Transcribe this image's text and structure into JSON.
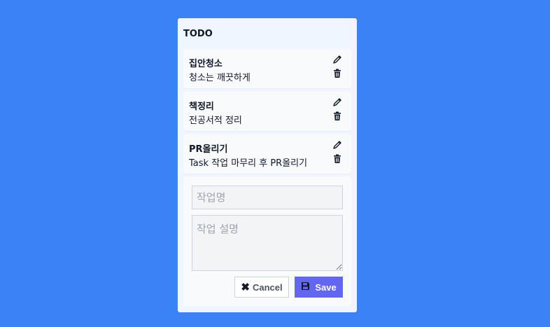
{
  "panel": {
    "title": "TODO"
  },
  "todos": [
    {
      "title": "집안청소",
      "description": "청소는 깨끗하게"
    },
    {
      "title": "책정리",
      "description": "전공서적 정리"
    },
    {
      "title": "PR올리기",
      "description": "Task 작업 마무리 후 PR올리기"
    }
  ],
  "form": {
    "title_placeholder": "작업명",
    "description_placeholder": "작업 설명",
    "cancel_label": "Cancel",
    "save_label": "Save",
    "cancel_icon": "close-icon",
    "save_icon": "floppy-disk-icon"
  },
  "colors": {
    "background": "#3b82f6",
    "panel": "#eff6ff",
    "save_button": "#6366f1"
  },
  "icons": {
    "edit": "pencil-icon",
    "delete": "trash-icon"
  }
}
